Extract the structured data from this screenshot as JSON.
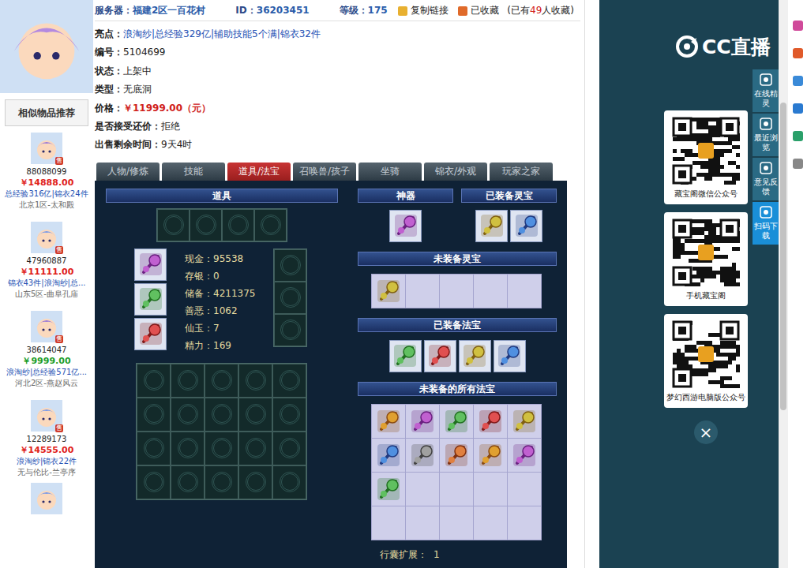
{
  "header": {
    "server_label": "服务器：",
    "server": "福建2区一百花村",
    "id_label": "ID：",
    "id": "36203451",
    "level_label": "等级：",
    "level": "175",
    "copy_link": "复制链接",
    "favorited": "已收藏",
    "fav_prefix": "(已有",
    "fav_count": "49",
    "fav_suffix": "人收藏)"
  },
  "info": [
    {
      "label": "亮点：",
      "value": "浪淘纱|总经验329亿|辅助技能5个满|锦衣32件",
      "kind": "highlight"
    },
    {
      "label": "编号：",
      "value": "5104699",
      "kind": "plain"
    },
    {
      "label": "状态：",
      "value": "上架中",
      "kind": "plain"
    },
    {
      "label": "类型：",
      "value": "无底洞",
      "kind": "plain"
    },
    {
      "label": "价格：",
      "value": "￥11999.00（元）",
      "kind": "price"
    },
    {
      "label": "是否接受还价：",
      "value": "拒绝",
      "kind": "plain"
    },
    {
      "label": "出售剩余时间：",
      "value": "9天4时",
      "kind": "plain"
    }
  ],
  "tabs": [
    {
      "label": "人物/修炼",
      "selected": false
    },
    {
      "label": "技能",
      "selected": false
    },
    {
      "label": "道具/法宝",
      "selected": true
    },
    {
      "label": "召唤兽/孩子",
      "selected": false
    },
    {
      "label": "坐骑",
      "selected": false
    },
    {
      "label": "锦衣/外观",
      "selected": false
    },
    {
      "label": "玩家之家",
      "selected": false
    }
  ],
  "inventory": {
    "title": "道具",
    "top_slots": [
      {
        "filled": false
      },
      {
        "filled": false
      },
      {
        "filled": false
      },
      {
        "filled": false
      }
    ],
    "equipped": [
      {
        "filled": true
      },
      {
        "filled": true
      },
      {
        "filled": true
      }
    ],
    "stats": [
      {
        "label": "现金：",
        "value": "95538"
      },
      {
        "label": "存银：",
        "value": "0"
      },
      {
        "label": "储备：",
        "value": "4211375"
      },
      {
        "label": "善恶：",
        "value": "1062"
      },
      {
        "label": "仙玉：",
        "value": "7"
      },
      {
        "label": "精力：",
        "value": "169"
      }
    ],
    "side_slots": [
      {
        "filled": false
      },
      {
        "filled": false
      },
      {
        "filled": false
      }
    ],
    "bag": [
      {
        "filled": false
      },
      {
        "filled": false
      },
      {
        "filled": false
      },
      {
        "filled": false
      },
      {
        "filled": false
      },
      {
        "filled": false
      },
      {
        "filled": false
      },
      {
        "filled": false
      },
      {
        "filled": false
      },
      {
        "filled": false
      },
      {
        "filled": false
      },
      {
        "filled": false
      },
      {
        "filled": false
      },
      {
        "filled": false
      },
      {
        "filled": false
      },
      {
        "filled": false
      },
      {
        "filled": false
      },
      {
        "filled": false
      },
      {
        "filled": false
      },
      {
        "filled": false
      }
    ]
  },
  "treasures": {
    "artifact": {
      "title": "神器",
      "items": [
        {
          "filled": true
        }
      ]
    },
    "lingbao_equipped": {
      "title": "已装备灵宝",
      "items": [
        {
          "filled": true
        },
        {
          "filled": true
        }
      ]
    },
    "lingbao_unequipped": {
      "title": "未装备灵宝",
      "slots": [
        {
          "filled": true
        },
        {
          "filled": false
        },
        {
          "filled": false
        },
        {
          "filled": false
        },
        {
          "filled": false
        }
      ]
    },
    "fabao_equipped": {
      "title": "已装备法宝",
      "items": [
        {
          "filled": true
        },
        {
          "filled": true
        },
        {
          "filled": true
        },
        {
          "filled": true
        }
      ]
    },
    "fabao_unequipped": {
      "title": "未装备的所有法宝",
      "slots": [
        {
          "filled": true
        },
        {
          "filled": true
        },
        {
          "filled": true
        },
        {
          "filled": true
        },
        {
          "filled": true
        },
        {
          "filled": true
        },
        {
          "filled": true
        },
        {
          "filled": true
        },
        {
          "filled": true
        },
        {
          "filled": true
        },
        {
          "filled": true
        },
        {
          "filled": false
        },
        {
          "filled": false
        },
        {
          "filled": false
        },
        {
          "filled": false
        },
        {
          "filled": false
        },
        {
          "filled": false
        },
        {
          "filled": false
        },
        {
          "filled": false
        },
        {
          "filled": false
        }
      ]
    },
    "expansion": {
      "label": "行囊扩展：",
      "value": "1"
    }
  },
  "sidebar": {
    "title": "相似物品推荐",
    "items": [
      {
        "badge": "售",
        "id": "88088099",
        "price": "￥14888.00",
        "color": "#e0201a",
        "tags": "总经验316亿|锦衣24件",
        "server": "北京1区-太和殿"
      },
      {
        "badge": "售",
        "id": "47960887",
        "price": "￥11111.00",
        "color": "#e0201a",
        "tags": "锦衣43件|浪淘纱|总...",
        "server": "山东5区-曲阜孔庙"
      },
      {
        "badge": "售",
        "id": "38614047",
        "price": "￥9999.00",
        "color": "#1f9e2a",
        "tags": "浪淘纱|总经验571亿...",
        "server": "河北2区-燕赵风云"
      },
      {
        "badge": "售",
        "id": "12289173",
        "price": "￥14555.00",
        "color": "#e0201a",
        "tags": "浪淘纱|锦衣22件",
        "server": "无与伦比-兰亭序"
      }
    ]
  },
  "overlay": {
    "logo": "CC直播",
    "qr_cards": [
      {
        "label": "藏宝阁微信公众号"
      },
      {
        "label": "手机藏宝阁"
      },
      {
        "label": "梦幻西游电脑版公众号"
      }
    ],
    "close": "×",
    "toolbar": [
      {
        "label": "在线精灵",
        "selected": false
      },
      {
        "label": "最近浏览",
        "selected": false
      },
      {
        "label": "意见反馈",
        "selected": false
      },
      {
        "label": "扫码下载",
        "selected": true
      }
    ]
  }
}
